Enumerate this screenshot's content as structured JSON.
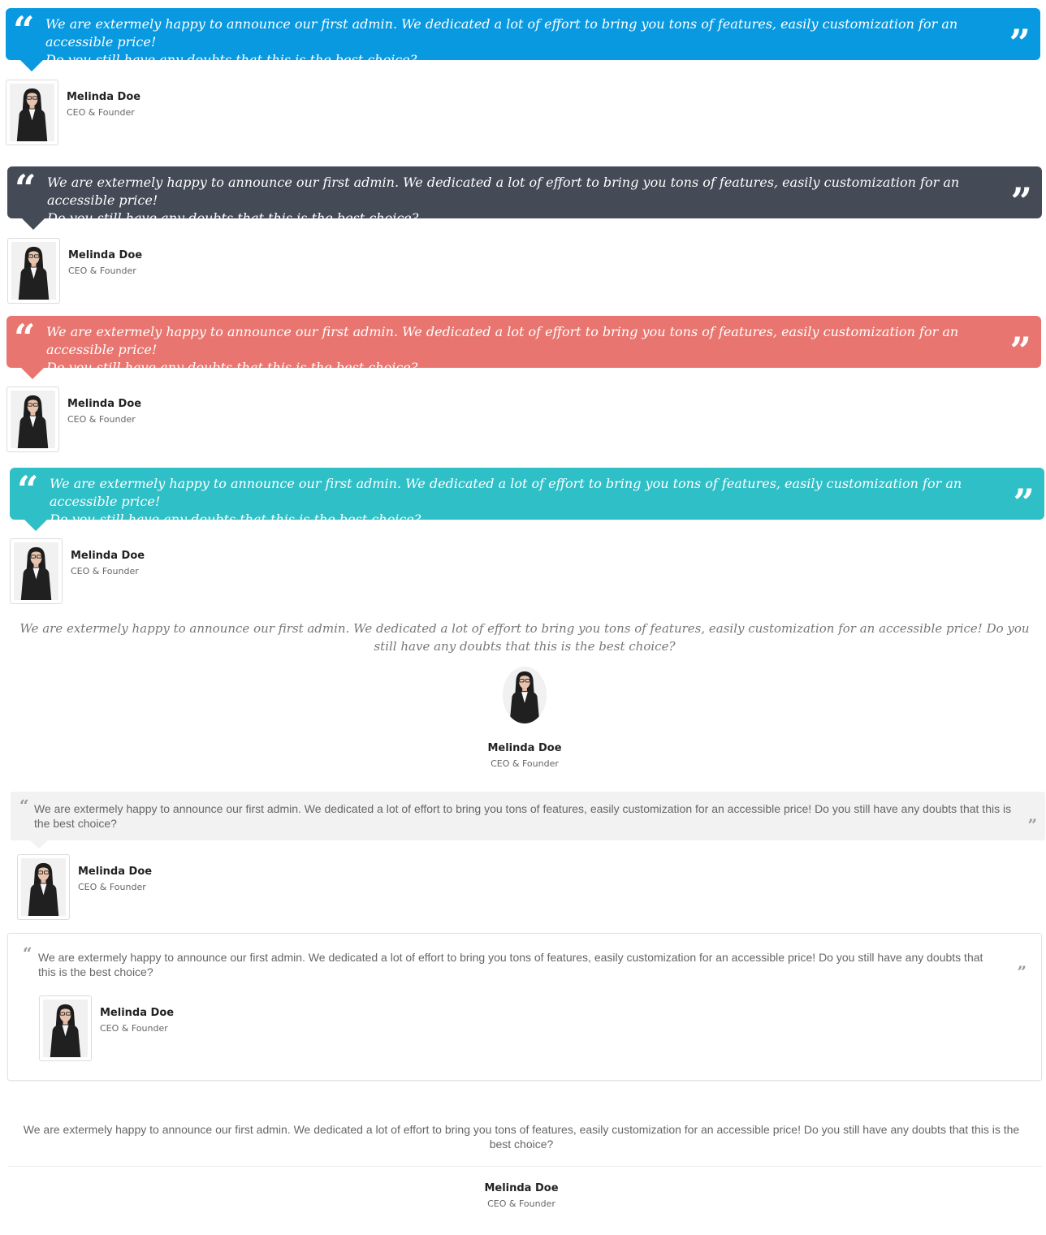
{
  "quote_text_two_line": [
    "We are extermely happy to announce our first admin. We dedicated a lot of effort to bring you tons of features, easily customization for an accessible price!",
    "Do you still have any doubts that this is the best choice?"
  ],
  "quote_text_full": "We are extermely happy to announce our first admin. We dedicated a lot of effort to bring you tons of features, easily customization for an accessible price! Do you still have any doubts that this is the best choice?",
  "author": {
    "name": "Melinda Doe",
    "role": "CEO & Founder"
  },
  "quote_marks": {
    "open": "“",
    "close": "”"
  },
  "colors": {
    "blue": "#0899e0",
    "dark": "#444b57",
    "coral": "#e8756f",
    "teal": "#2fbfc7",
    "gray_bubble": "#f2f2f2"
  },
  "icons": {
    "avatar": "person-photo-icon",
    "open_quote": "open-quote-icon",
    "close_quote": "close-quote-icon"
  }
}
